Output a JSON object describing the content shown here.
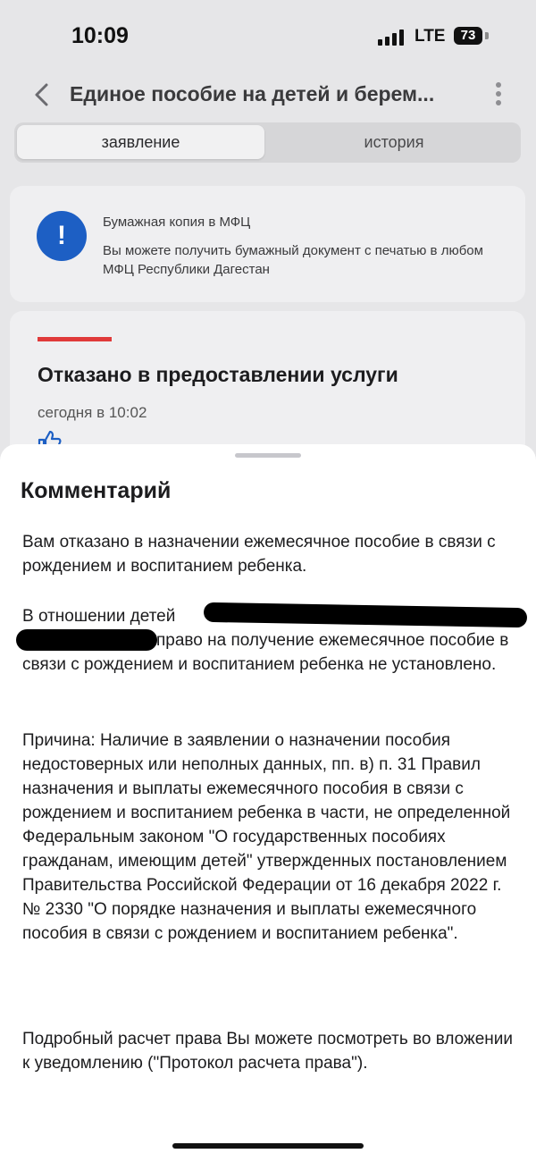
{
  "status_bar": {
    "time": "10:09",
    "network": "LTE",
    "battery": "73"
  },
  "header": {
    "title": "Единое пособие на детей и берем..."
  },
  "tabs": [
    {
      "label": "заявление",
      "active": true
    },
    {
      "label": "история",
      "active": false
    }
  ],
  "info_card": {
    "icon": "exclamation-icon",
    "title": "Бумажная копия в МФЦ",
    "text": "Вы можете получить бумажный документ с печатью в любом МФЦ Республики Дагестан"
  },
  "status_card": {
    "title": "Отказано в предоставлении услуги",
    "time": "сегодня в 10:02",
    "accent_color": "#e03a3a"
  },
  "comment_sheet": {
    "title": "Комментарий",
    "paragraph1": "Вам отказано в назначении ежемесячное пособие в связи с рождением и воспитанием ребенка.",
    "paragraph2_start": "В отношении детей",
    "paragraph2_rest": "право на получение ежемесячное пособие в связи с рождением и воспитанием ребенка не установлено.",
    "paragraph3": "Причина: Наличие в заявлении о назначении пособия недостоверных или неполных данных, пп. в) п. 31 Правил назначения и выплаты ежемесячного пособия в связи с рождением и воспитанием ребенка в части, не определенной Федеральным законом \"О государственных пособиях гражданам, имеющим детей\" утвержденных постановлением Правительства Российской Федерации от 16 декабря 2022 г. № 2330 \"О порядке назначения и выплаты ежемесячного пособия в связи с рождением и воспитанием ребенка\".",
    "paragraph4": "Подробный расчет права Вы можете посмотреть во вложении к уведомлению (\"Протокол расчета права\")."
  },
  "colors": {
    "accent_blue": "#1d5fc4",
    "background": "#e6e6e8"
  }
}
